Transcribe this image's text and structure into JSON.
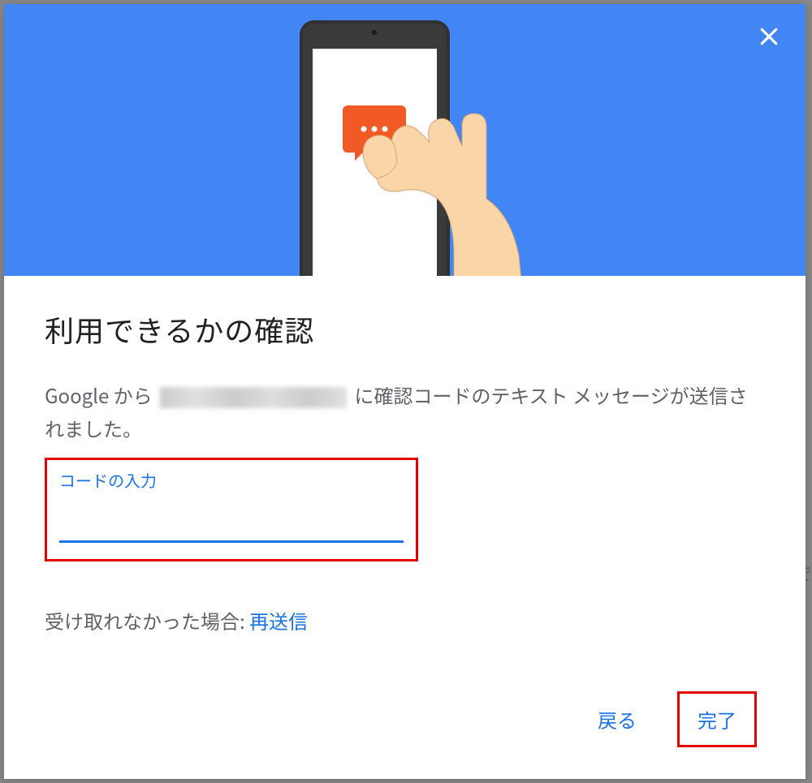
{
  "dialog": {
    "title": "利用できるかの確認",
    "description_prefix": "Google から ",
    "description_suffix": " に確認コードのテキスト メッセージが送信されました。",
    "input_label": "コードの入力",
    "input_value": "",
    "resend_prefix": "受け取れなかった場合: ",
    "resend_link": "再送信",
    "back_button": "戻る",
    "done_button": "完了"
  },
  "colors": {
    "primary": "#1a73e8",
    "hero_bg": "#4285f4",
    "chat_bubble": "#f15a24",
    "highlight_border": "#e60000"
  },
  "behind": {
    "fragment": "で"
  }
}
